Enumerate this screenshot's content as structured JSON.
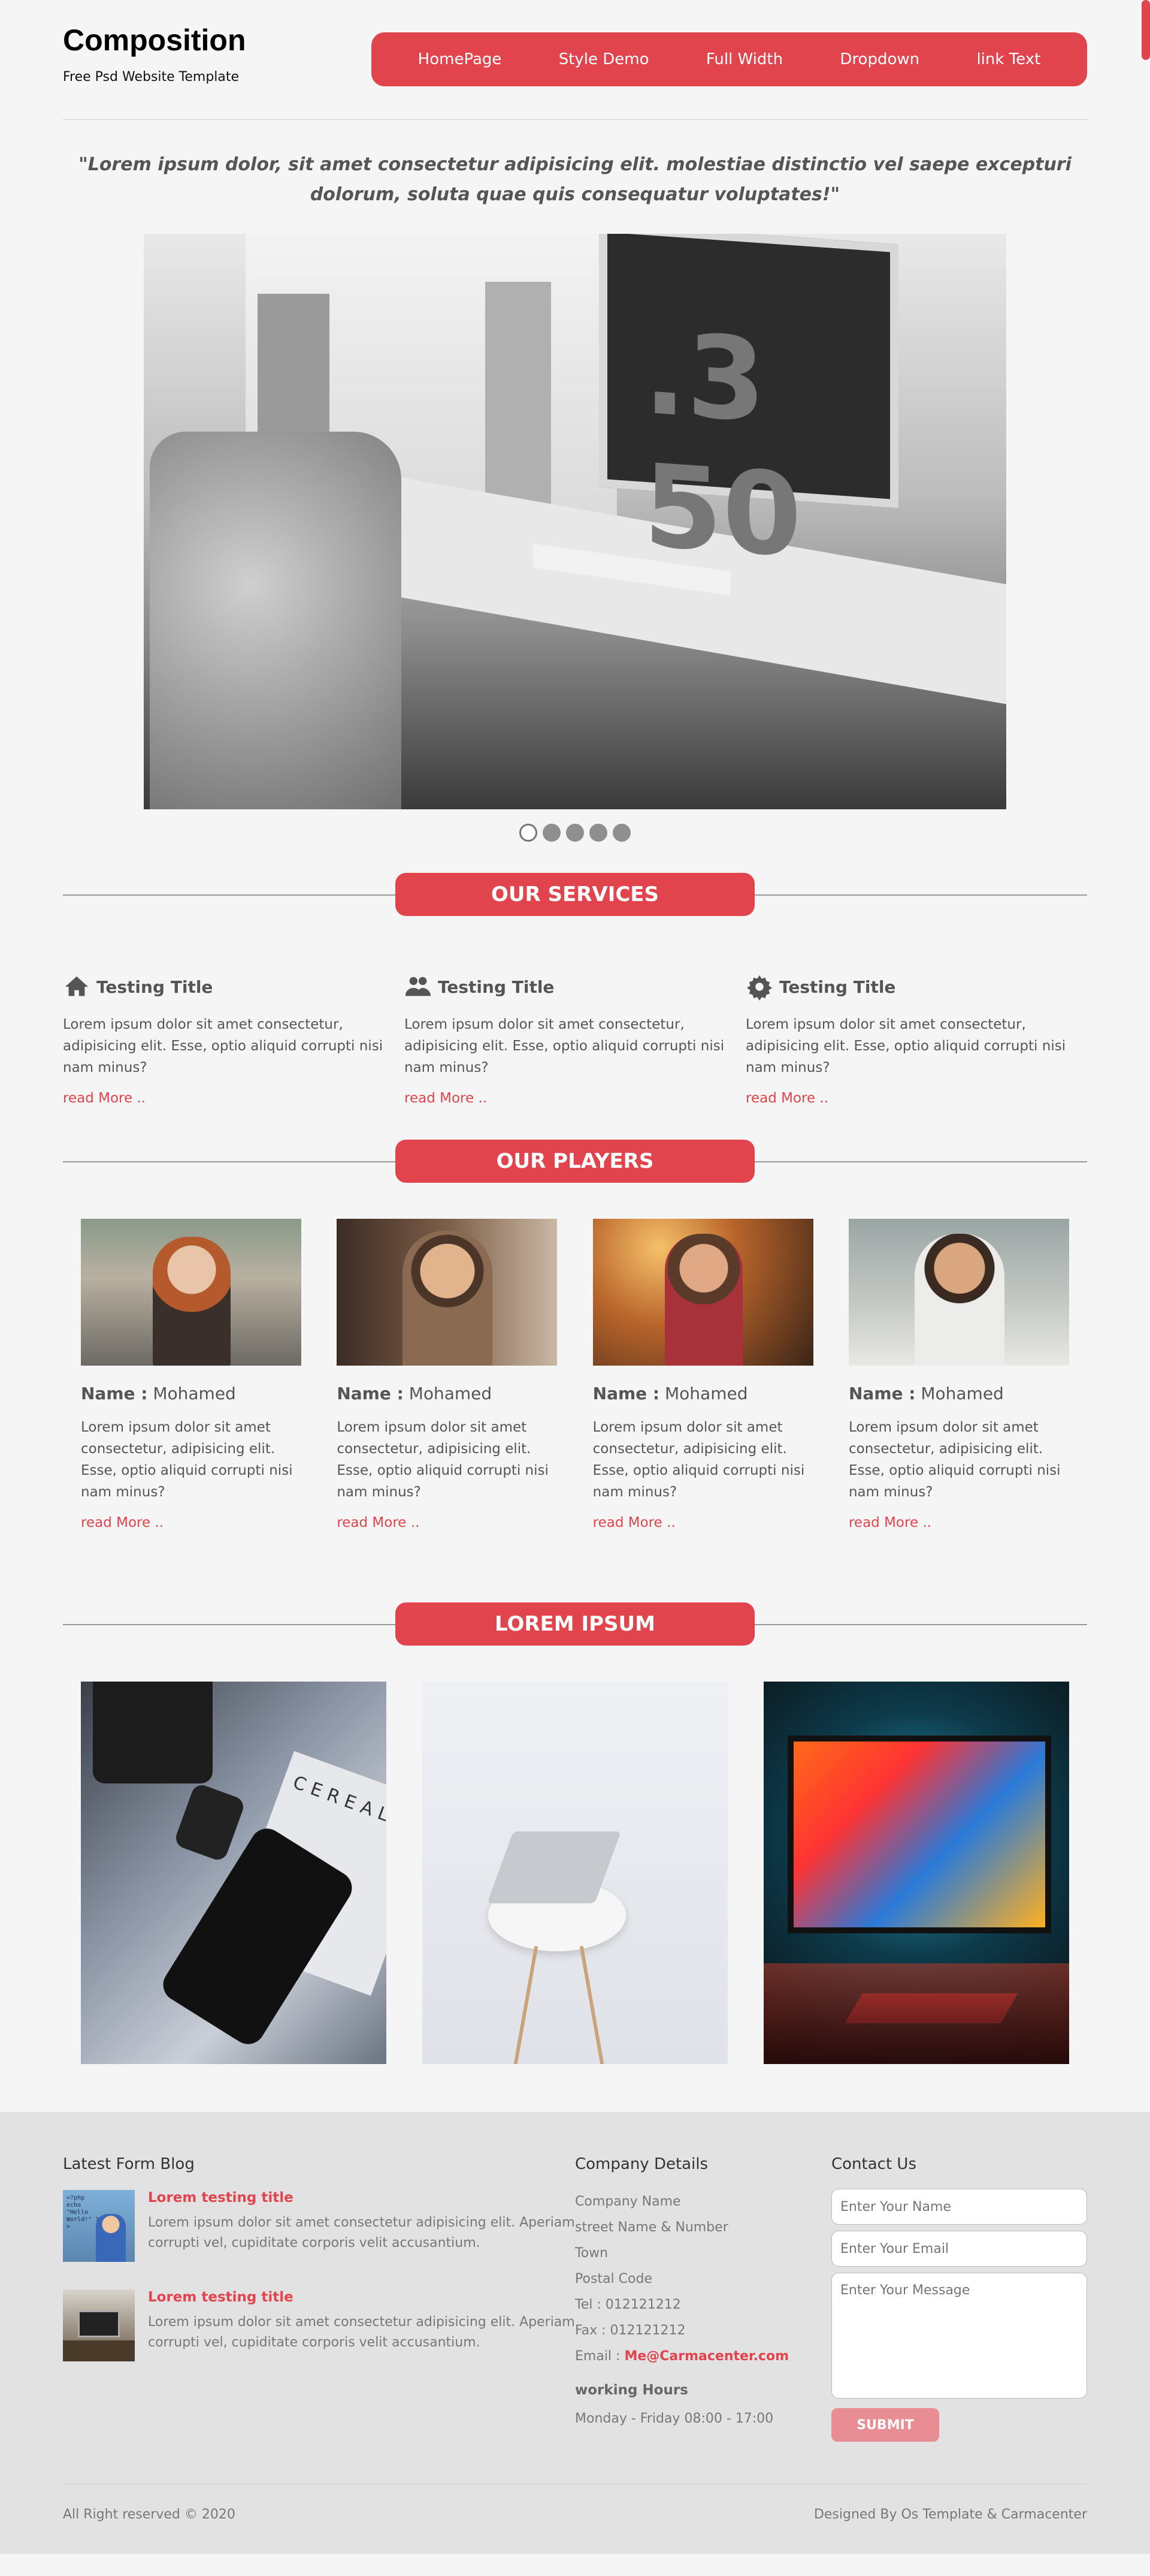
{
  "header": {
    "title": "Composition",
    "subtitle": "Free Psd Website Template",
    "nav": [
      "HomePage",
      "Style Demo",
      "Full Width",
      "Dropdown",
      "link Text"
    ]
  },
  "quote": "\"Lorem ipsum dolor, sit amet consectetur adipisicing elit. molestiae distinctio vel saepe excepturi dolorum, soluta quae quis consequatur voluptates!\"",
  "hero": {
    "monitor_text": ".3 50"
  },
  "slider": {
    "dots": 5,
    "active": 1
  },
  "services": {
    "heading": "OUR SERVICES",
    "items": [
      {
        "icon": "home-icon",
        "title": "Testing Title",
        "text": "Lorem ipsum dolor sit amet consectetur, adipisicing elit. Esse, optio aliquid corrupti nisi nam minus?",
        "link": "read More .."
      },
      {
        "icon": "users-icon",
        "title": "Testing Title",
        "text": "Lorem ipsum dolor sit amet consectetur, adipisicing elit. Esse, optio aliquid corrupti nisi nam minus?",
        "link": "read More .."
      },
      {
        "icon": "gear-icon",
        "title": "Testing Title",
        "text": "Lorem ipsum dolor sit amet consectetur, adipisicing elit. Esse, optio aliquid corrupti nisi nam minus?",
        "link": "read More .."
      }
    ]
  },
  "players": {
    "heading": "OUR PLAYERS",
    "name_label": "Name :",
    "items": [
      {
        "name": "Mohamed",
        "text": "Lorem ipsum dolor sit amet consectetur, adipisicing elit. Esse, optio aliquid corrupti nisi nam minus?",
        "link": "read More .."
      },
      {
        "name": "Mohamed",
        "text": "Lorem ipsum dolor sit amet consectetur, adipisicing elit. Esse, optio aliquid corrupti nisi nam minus?",
        "link": "read More .."
      },
      {
        "name": "Mohamed",
        "text": "Lorem ipsum dolor sit amet consectetur, adipisicing elit. Esse, optio aliquid corrupti nisi nam minus?",
        "link": "read More .."
      },
      {
        "name": "Mohamed",
        "text": "Lorem ipsum dolor sit amet consectetur, adipisicing elit. Esse, optio aliquid corrupti nisi nam minus?",
        "link": "read More .."
      }
    ]
  },
  "gallery": {
    "heading": "LOREM IPSUM",
    "cereal_text": "CEREAL"
  },
  "footer": {
    "blog_heading": "Latest Form Blog",
    "posts": [
      {
        "title": "Lorem testing title",
        "text": "Lorem ipsum dolor sit amet consectetur adipisicing elit. Aperiam corrupti vel, cupiditate corporis velit accusantium.",
        "thumb_text": "<?php echo \"Hello World!\" ?>"
      },
      {
        "title": "Lorem testing title",
        "text": "Lorem ipsum dolor sit amet consectetur adipisicing elit. Aperiam corrupti vel, cupiditate corporis velit accusantium."
      }
    ],
    "company_heading": "Company Details",
    "company_lines": [
      "Company Name",
      "street Name & Number",
      "Town",
      "Postal Code",
      "Tel : 012121212",
      "Fax : 012121212"
    ],
    "email_label": "Email :",
    "email": "Me@Carmacenter.com",
    "hours_heading": "working Hours",
    "hours": "Monday - Friday 08:00 - 17:00",
    "contact_heading": "Contact Us",
    "name_placeholder": "Enter Your Name",
    "email_placeholder": "Enter Your Email",
    "message_placeholder": "Enter Your Message",
    "submit": "SUBMIT",
    "copyright": "All Right reserved © 2020",
    "designed_by": "Designed By Os Template & Carmacenter"
  },
  "colors": {
    "accent": "#e2444d",
    "background": "#f5f5f5",
    "footer_bg": "#e2e2e2"
  }
}
